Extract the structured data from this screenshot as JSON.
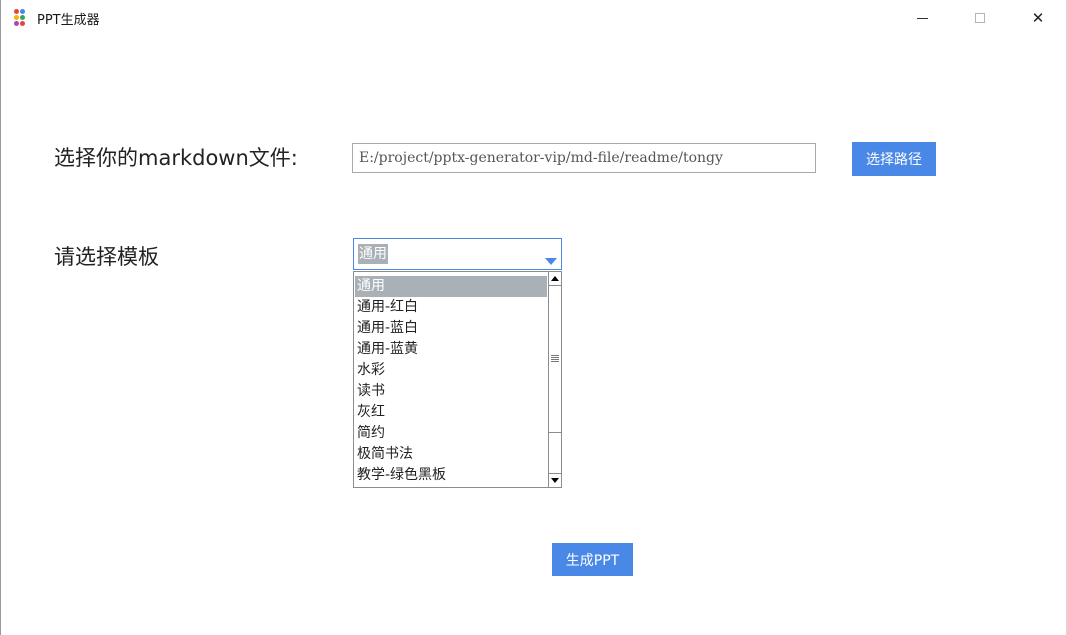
{
  "window": {
    "title": "PPT生成器",
    "app_icon": "colored-dots-icon",
    "app_icon_colors": [
      "#e8453c",
      "#4a88e8",
      "#f5b400",
      "#34a853",
      "#ab47bc",
      "#e8453c"
    ],
    "minimize_icon": "minimize-icon",
    "maximize_icon": "maximize-icon",
    "close_icon": "close-icon",
    "close_glyph": "✕"
  },
  "form": {
    "file_label": "选择你的markdown文件:",
    "file_path_value": "E:/project/pptx-generator-vip/md-file/readme/tongy",
    "choose_path_label": "选择路径",
    "template_label": "请选择模板",
    "template_selected": "通用",
    "generate_label": "生成PPT"
  },
  "dropdown": {
    "items": [
      "通用",
      "通用-红白",
      "通用-蓝白",
      "通用-蓝黄",
      "水彩",
      "读书",
      "灰红",
      "简约",
      "极简书法",
      "教学-绿色黑板"
    ],
    "selected_index": 0
  },
  "colors": {
    "accent": "#4a88e8",
    "selection": "#a9b0b6"
  }
}
